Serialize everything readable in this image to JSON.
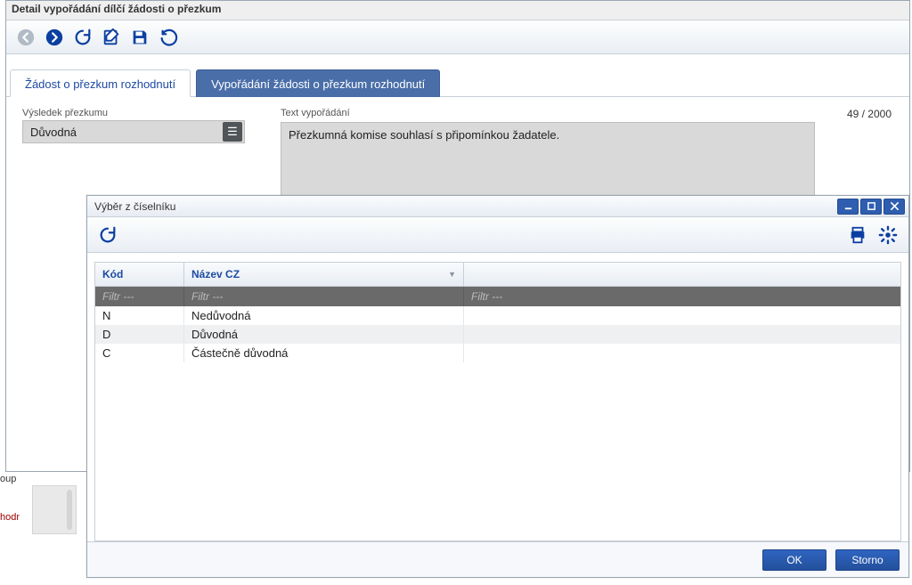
{
  "parent": {
    "title": "Detail vypořádání dílčí žádosti o přezkum"
  },
  "tabs": {
    "request": "Žádost o přezkum rozhodnutí",
    "settlement": "Vypořádání žádosti o  přezkum rozhodnutí"
  },
  "form": {
    "result_label": "Výsledek přezkumu",
    "result_value": "Důvodná",
    "text_label": "Text vypořádání",
    "text_value": "Přezkumná komise souhlasí s připomínkou žadatele.",
    "counter": "49 / 2000"
  },
  "fragments": {
    "one": "oup",
    "two": "hodn"
  },
  "modal": {
    "title": "Výběr z číselníku",
    "headers": {
      "code": "Kód",
      "name": "Název CZ"
    },
    "filter_placeholder": "Filtr ---",
    "rows": [
      {
        "code": "N",
        "name": "Nedůvodná"
      },
      {
        "code": "D",
        "name": "Důvodná"
      },
      {
        "code": "C",
        "name": "Částečně důvodná"
      }
    ],
    "ok": "OK",
    "cancel": "Storno"
  },
  "icons": {
    "list_glyph": "☰"
  }
}
